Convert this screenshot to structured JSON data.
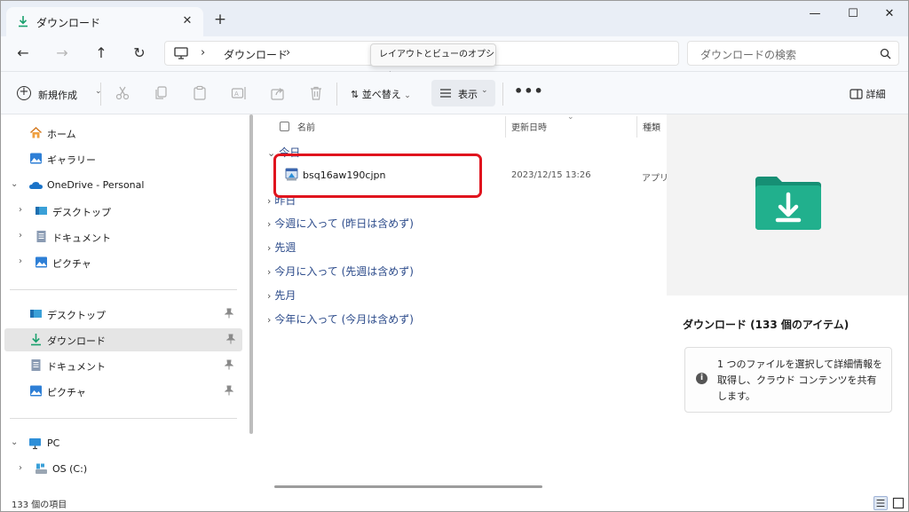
{
  "window": {
    "tab_title": "ダウンロード",
    "tab_close": "✕",
    "new_tab": "+",
    "minimize": "—",
    "maximize": "☐",
    "close": "✕"
  },
  "nav": {
    "back": "←",
    "forward": "→",
    "up": "↑",
    "refresh": "↻",
    "breadcrumb": [
      "ダウンロード"
    ],
    "search_placeholder": "ダウンロードの検索",
    "tooltip": "レイアウトとビューのオプション。"
  },
  "toolbar": {
    "new_label": "新規作成",
    "sort_label": "並べ替え",
    "view_label": "表示",
    "more_label": "•••",
    "details_label": "詳細",
    "icons": [
      "cut-icon",
      "copy-icon",
      "paste-icon",
      "rename-icon",
      "share-icon",
      "delete-icon"
    ]
  },
  "sidebar": {
    "quick": [
      {
        "label": "ホーム",
        "icon": "home-icon"
      },
      {
        "label": "ギャラリー",
        "icon": "gallery-icon"
      }
    ],
    "onedrive": {
      "label": "OneDrive - Personal",
      "children": [
        "デスクトップ",
        "ドキュメント",
        "ピクチャ"
      ]
    },
    "pinned": [
      {
        "label": "デスクトップ",
        "icon": "desktop-icon"
      },
      {
        "label": "ダウンロード",
        "icon": "download-icon",
        "selected": true
      },
      {
        "label": "ドキュメント",
        "icon": "document-icon"
      },
      {
        "label": "ピクチャ",
        "icon": "pictures-icon"
      }
    ],
    "pc": {
      "label": "PC",
      "children": [
        "OS (C:)"
      ]
    }
  },
  "filelist": {
    "columns": [
      "名前",
      "更新日時",
      "種類"
    ],
    "groups": [
      "今日",
      "昨日",
      "今週に入って (昨日は含めず)",
      "先週",
      "今月に入って (先週は含めず)",
      "先月",
      "今年に入って (今月は含めず)"
    ],
    "files": [
      {
        "name": "bsq16aw190cjpn",
        "modified": "2023/12/15 13:26",
        "type": "アプリケーション"
      }
    ]
  },
  "details": {
    "title": "ダウンロード (133 個のアイテム)",
    "info": "1 つのファイルを選択して詳細情報を取得し、クラウド コンテンツを共有します。"
  },
  "status": {
    "count": "133 個の項目"
  },
  "colors": {
    "accent": "#1a73c8",
    "folder_teal": "#1fa489",
    "highlight_red": "#e0141e"
  }
}
